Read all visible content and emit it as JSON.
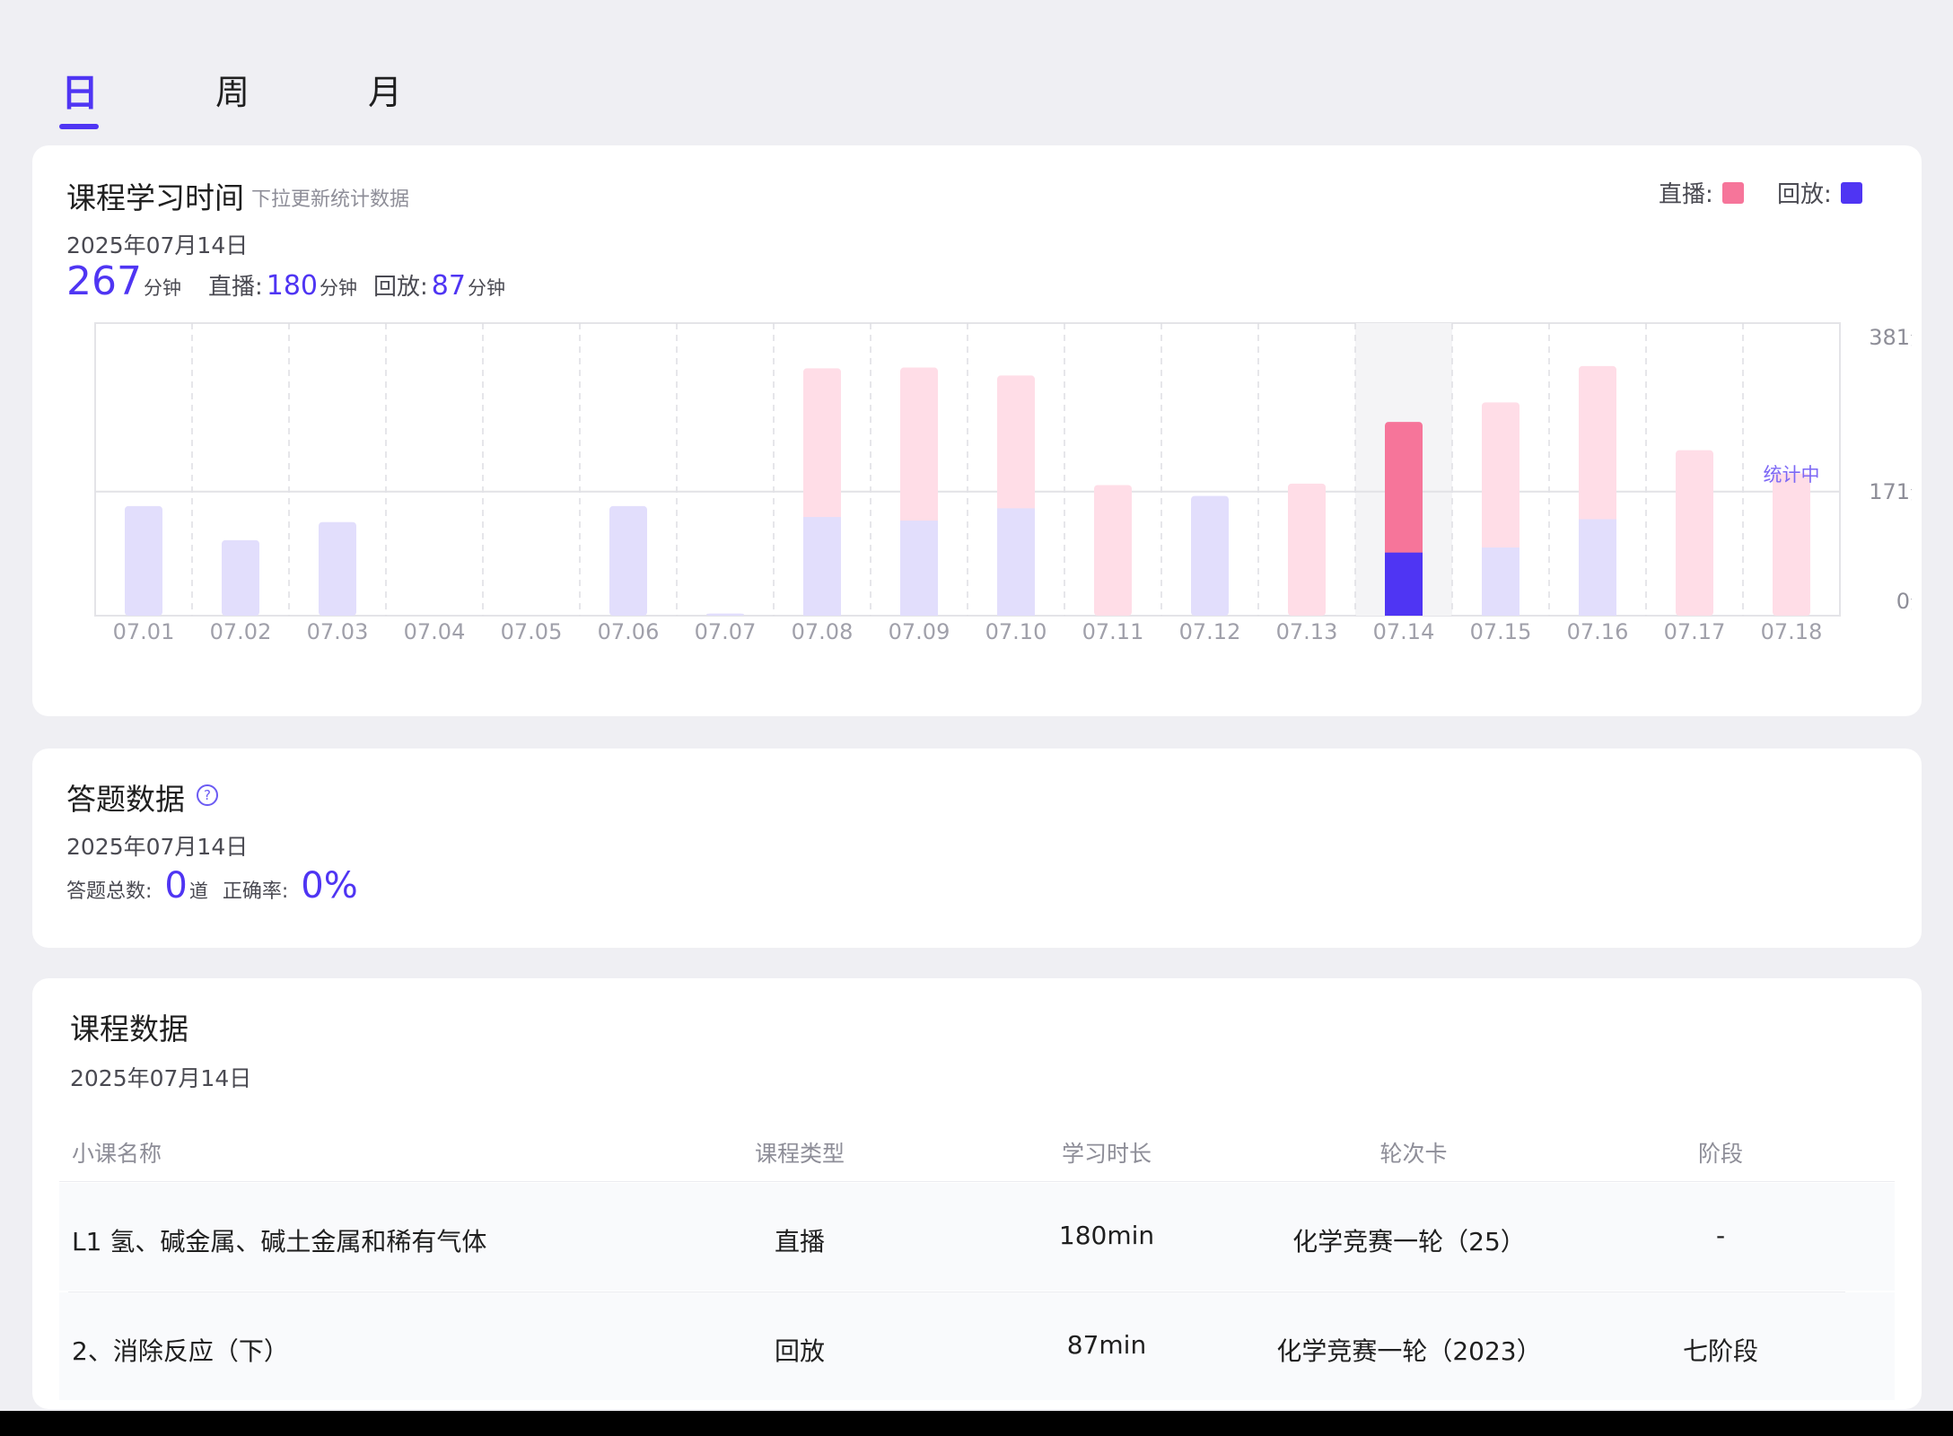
{
  "tabs": [
    {
      "label": "日",
      "active": true
    },
    {
      "label": "周",
      "active": false
    },
    {
      "label": "月",
      "active": false
    }
  ],
  "study_time": {
    "title": "课程学习时间",
    "hint": "下拉更新统计数据",
    "date": "2025年07月14日",
    "total_value": "267",
    "unit": "分钟",
    "live_label": "直播:",
    "live_value": "180",
    "replay_label": "回放:",
    "replay_value": "87",
    "legend": {
      "live_label": "直播:",
      "replay_label": "回放:",
      "live_color": "#f6759a",
      "replay_color": "#4f35f3"
    }
  },
  "chart_data": {
    "type": "bar",
    "stacked": true,
    "categories": [
      "07.01",
      "07.02",
      "07.03",
      "07.04",
      "07.05",
      "07.06",
      "07.07",
      "07.08",
      "07.09",
      "07.10",
      "07.11",
      "07.12",
      "07.13",
      "07.14",
      "07.15",
      "07.16",
      "07.17",
      "07.18"
    ],
    "series": [
      {
        "name": "回放",
        "values": [
          151,
          104,
          129,
          0,
          0,
          151,
          3,
          136,
          131,
          148,
          0,
          165,
          0,
          87,
          94,
          133,
          0,
          0
        ],
        "color": "#4f35f3"
      },
      {
        "name": "直播",
        "values": [
          0,
          0,
          0,
          0,
          0,
          0,
          0,
          205,
          211,
          183,
          180,
          0,
          182,
          180,
          200,
          211,
          228,
          196
        ],
        "color": "#f6759a"
      }
    ],
    "highlight_category": "07.14",
    "y_ticks": [
      "0分",
      "171分",
      "381分"
    ],
    "ylim": [
      0,
      381
    ],
    "annotation": "统计中",
    "grid": true
  },
  "quiz": {
    "title": "答题数据",
    "date": "2025年07月14日",
    "total_label": "答题总数:",
    "total_value": "0",
    "total_unit": "道",
    "accuracy_label": "正确率:",
    "accuracy_value": "0%"
  },
  "course": {
    "title": "课程数据",
    "date": "2025年07月14日",
    "columns": [
      "小课名称",
      "课程类型",
      "学习时长",
      "轮次卡",
      "阶段"
    ],
    "rows": [
      {
        "name": "L1 氢、碱金属、碱土金属和稀有气体",
        "type": "直播",
        "duration": "180min",
        "card": "化学竞赛一轮（25）",
        "stage": "-"
      },
      {
        "name": "2、消除反应（下）",
        "type": "回放",
        "duration": "87min",
        "card": "化学竞赛一轮（2023）",
        "stage": "七阶段"
      }
    ]
  }
}
